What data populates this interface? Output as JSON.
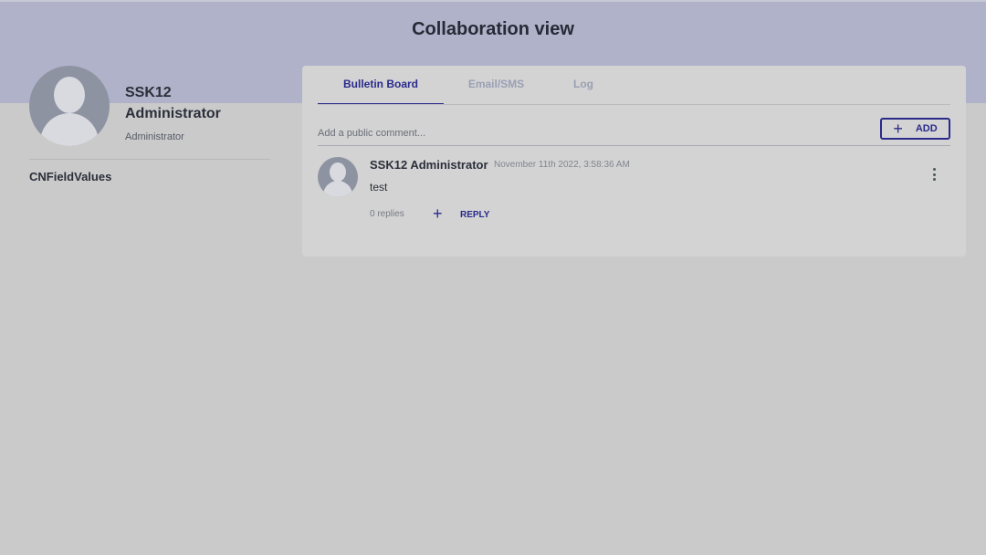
{
  "page": {
    "title": "Collaboration view"
  },
  "user": {
    "name_lines": [
      "SSK12",
      "Administrator"
    ],
    "role": "Administrator"
  },
  "sidebar": {
    "items": [
      {
        "label": "CNFieldValues"
      }
    ]
  },
  "tabs": [
    {
      "label": "Bulletin Board",
      "active": true
    },
    {
      "label": "Email/SMS",
      "active": false
    },
    {
      "label": "Log",
      "active": false
    }
  ],
  "comment_input": {
    "placeholder": "Add a public comment...",
    "add_label": "ADD",
    "add_icon": "+"
  },
  "comments": [
    {
      "author": "SSK12 Administrator",
      "timestamp": "November 11th 2022, 3:58:36 AM",
      "text": "test",
      "replies": "0 replies",
      "reply_icon": "+",
      "reply_label": "REPLY"
    }
  ],
  "icons": {
    "avatar": "user-silhouette-icon",
    "add": "plus-icon",
    "reply": "plus-icon",
    "menu": "more-vertical-icon"
  },
  "colors": {
    "accent": "#2a2a8c",
    "header": "#b0b2c9",
    "background": "#cacaca",
    "card": "#d3d3d3",
    "inactive_tab": "#9aa0b4",
    "kebab": "#4a5a52"
  }
}
